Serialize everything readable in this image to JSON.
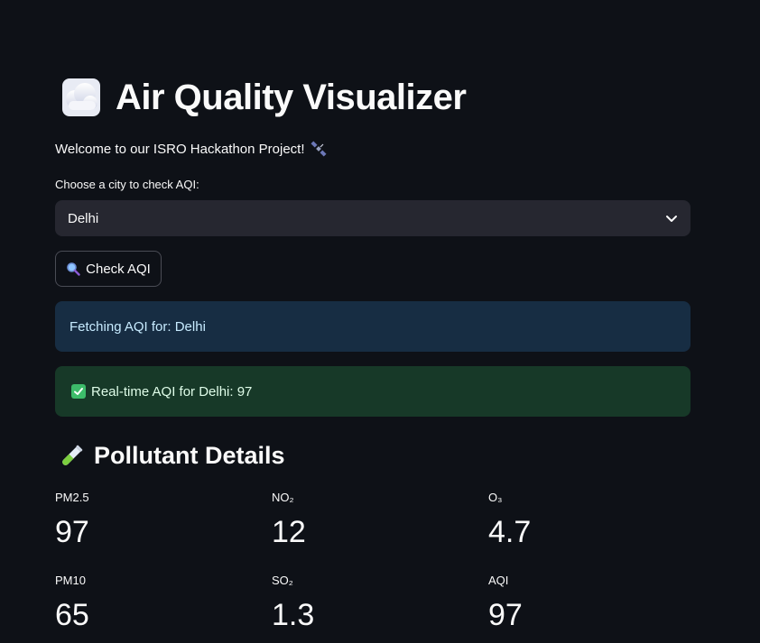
{
  "header": {
    "title": "Air Quality Visualizer",
    "title_icon": "cloud-icon",
    "welcome": "Welcome to our ISRO Hackathon Project!",
    "welcome_icon": "satellite-icon"
  },
  "city_select": {
    "label": "Choose a city to check AQI:",
    "value": "Delhi"
  },
  "check_button": {
    "label": "Check AQI",
    "icon": "magnifier-icon"
  },
  "alerts": {
    "info": "Fetching AQI for: Delhi",
    "success": "Real-time AQI for Delhi: 97"
  },
  "pollutants": {
    "title": "Pollutant Details",
    "icon": "test-tube-icon",
    "metrics": [
      {
        "label": "PM2.5",
        "value": "97"
      },
      {
        "label": "NO₂",
        "value": "12"
      },
      {
        "label": "O₃",
        "value": "4.7"
      },
      {
        "label": "PM10",
        "value": "65"
      },
      {
        "label": "SO₂",
        "value": "1.3"
      },
      {
        "label": "AQI",
        "value": "97"
      }
    ]
  },
  "colors": {
    "background": "#0e1117",
    "info_bg": "#172d43",
    "success_bg": "#173928",
    "select_bg": "#262730"
  }
}
